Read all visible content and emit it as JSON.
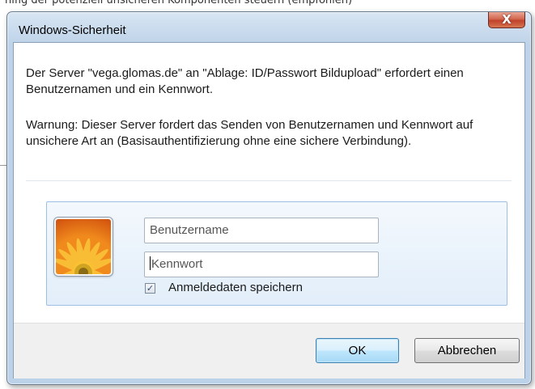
{
  "background": {
    "text": "nifig der potenziell unsicheren Komponenten steuern (empfohlen)"
  },
  "dialog": {
    "title": "Windows-Sicherheit",
    "close_symbol": "X",
    "message": "Der Server \"vega.glomas.de\" an \"Ablage: ID/Passwort Bildupload\" erfordert einen Benutzernamen und ein Kennwort.",
    "warning": "Warnung: Dieser Server fordert das Senden von Benutzernamen und Kennwort auf unsichere Art an (Basisauthentifizierung ohne eine sichere Verbindung).",
    "username_placeholder": "Benutzername",
    "password_placeholder": "Kennwort",
    "remember_label": "Anmeldedaten speichern",
    "remember_checked": true,
    "ok_label": "OK",
    "cancel_label": "Abbrechen"
  },
  "icons": {
    "close": "close-icon",
    "user_tile": "user-avatar-icon",
    "checkbox": "checkmark-icon"
  },
  "colors": {
    "title_bar": "#c7d9ec",
    "close_button": "#c0412a",
    "credential_panel": "#e2eefa",
    "button_bar": "#f0f0f0",
    "default_button": "#bee6fd"
  }
}
